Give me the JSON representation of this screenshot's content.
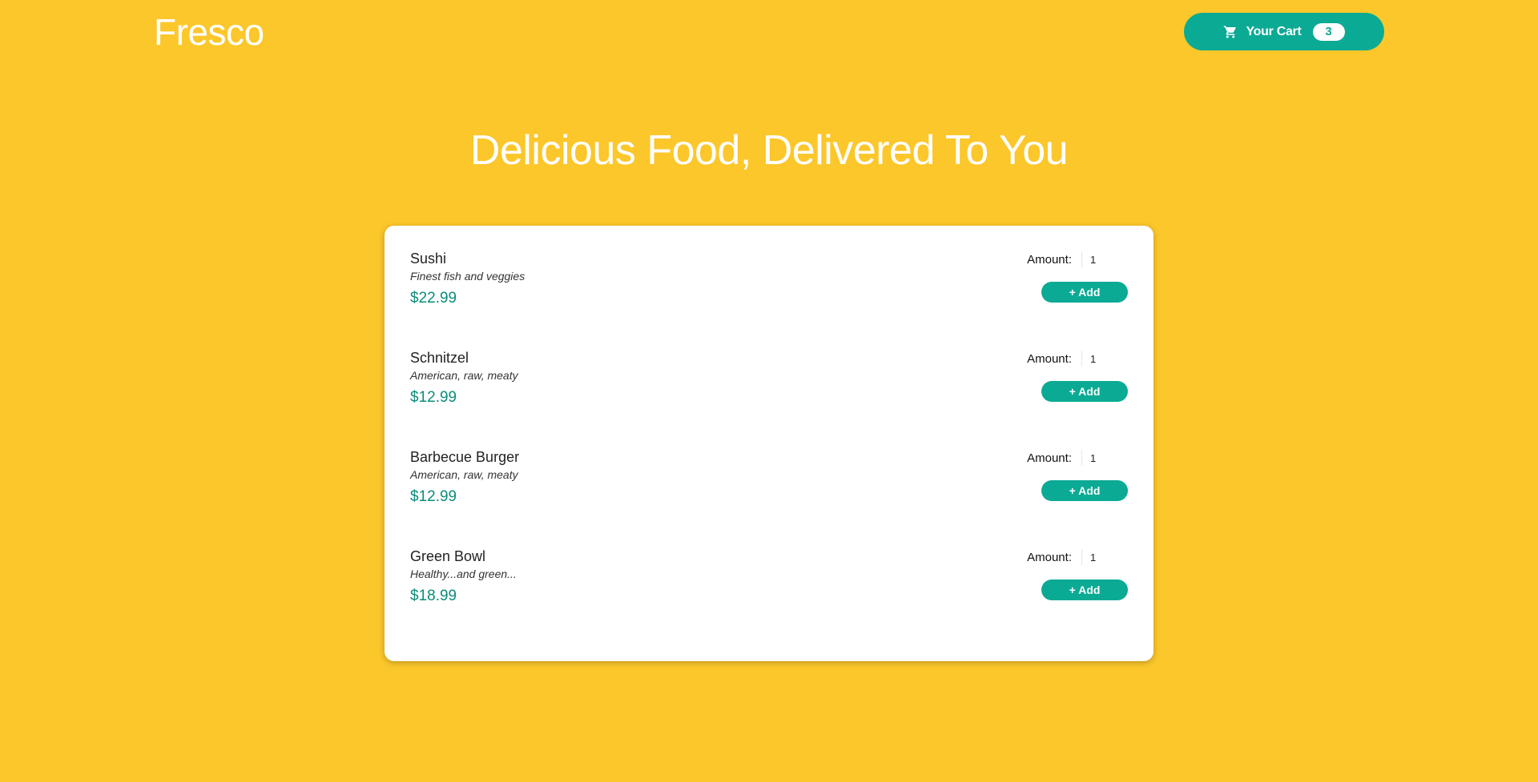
{
  "header": {
    "logo": "Fresco",
    "cart": {
      "label": "Your Cart",
      "icon": "shopping-cart-icon",
      "count": "3"
    }
  },
  "hero": {
    "title": "Delicious Food, Delivered To You"
  },
  "meals": [
    {
      "name": "Sushi",
      "description": "Finest fish and veggies",
      "price": "$22.99",
      "amount_label": "Amount:",
      "amount_value": "1",
      "add_label": "+ Add"
    },
    {
      "name": "Schnitzel",
      "description": "American, raw, meaty",
      "price": "$12.99",
      "amount_label": "Amount:",
      "amount_value": "1",
      "add_label": "+ Add"
    },
    {
      "name": "Barbecue Burger",
      "description": "American, raw, meaty",
      "price": "$12.99",
      "amount_label": "Amount:",
      "amount_value": "1",
      "add_label": "+ Add"
    },
    {
      "name": "Green Bowl",
      "description": "Healthy...and green...",
      "price": "$18.99",
      "amount_label": "Amount:",
      "amount_value": "1",
      "add_label": "+ Add"
    }
  ],
  "colors": {
    "background": "#FCC72B",
    "accent": "#0BAA94",
    "price": "#0B8C7A",
    "card": "#FFFFFF"
  }
}
